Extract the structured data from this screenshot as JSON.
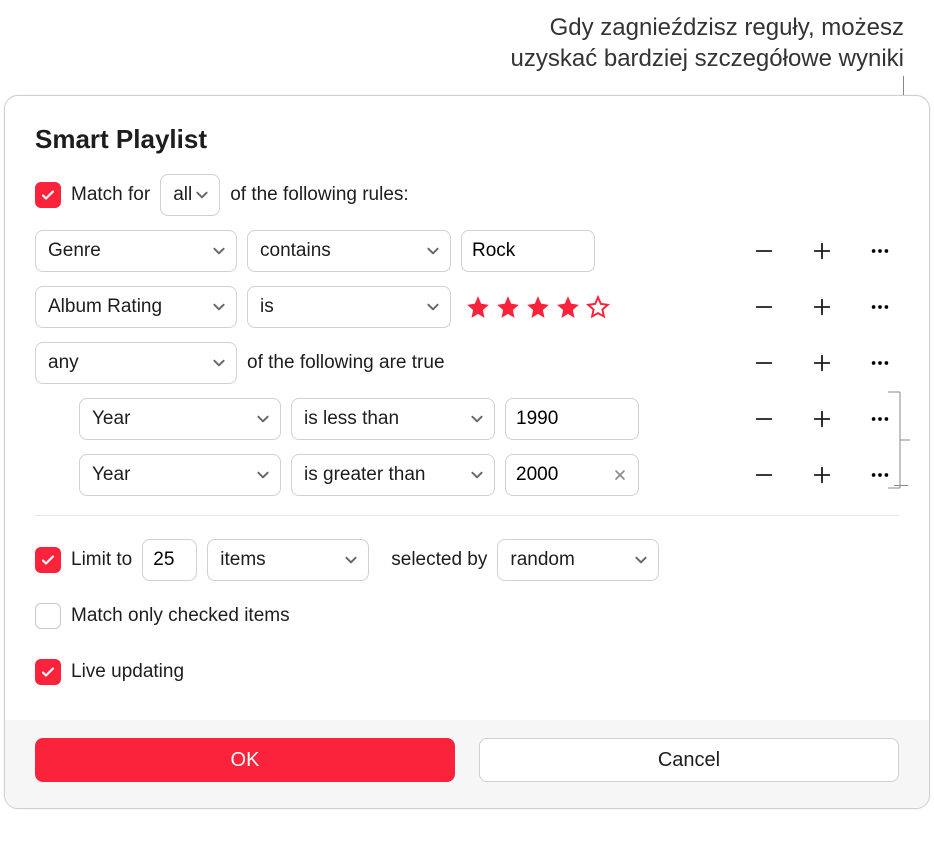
{
  "callout": {
    "line1": "Gdy zagnieździsz reguły, możesz",
    "line2": "uzyskać bardziej szczegółowe wyniki"
  },
  "dialog": {
    "title": "Smart Playlist",
    "match": {
      "prefix": "Match  for",
      "mode": "all",
      "suffix": "of the following rules:"
    },
    "rules": [
      {
        "field": "Genre",
        "op": "contains",
        "value": "Rock"
      },
      {
        "field": "Album Rating",
        "op": "is",
        "stars": 4
      },
      {
        "field": "any",
        "suffix": "of the following are true"
      },
      {
        "field": "Year",
        "op": "is less than",
        "value": "1990"
      },
      {
        "field": "Year",
        "op": "is greater than",
        "value": "2000"
      }
    ],
    "limit": {
      "label": "Limit to",
      "count": "25",
      "unit": "items",
      "selectedByLabel": "selected by",
      "selectedBy": "random"
    },
    "matchChecked": "Match only checked items",
    "liveUpdating": "Live updating",
    "buttons": {
      "ok": "OK",
      "cancel": "Cancel"
    }
  },
  "colors": {
    "accent": "#fa233b"
  }
}
